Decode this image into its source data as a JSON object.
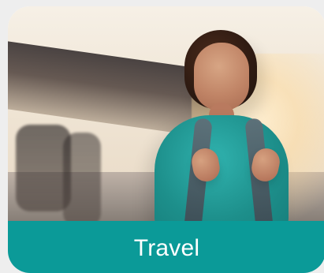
{
  "card": {
    "label": "Travel",
    "accent_color": "#0b9a98",
    "photo_icon": "photo-illustration"
  }
}
